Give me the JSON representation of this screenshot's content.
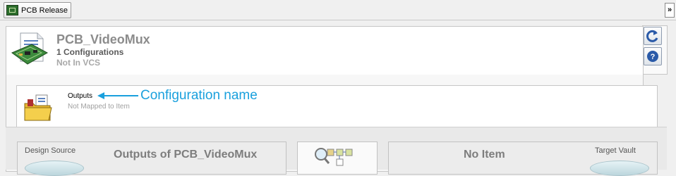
{
  "tab": {
    "label": "PCB Release"
  },
  "overflow": {
    "label": "»"
  },
  "project": {
    "title": "PCB_VideoMux",
    "configurations": "1 Configurations",
    "vcs_status": "Not In VCS"
  },
  "configuration": {
    "name": "Outputs",
    "mapping": "Not Mapped to Item",
    "annotation": "Configuration name"
  },
  "source": {
    "label": "Design Source",
    "title": "Outputs of PCB_VideoMux"
  },
  "target": {
    "label": "Target Vault",
    "title": "No Item"
  },
  "colors": {
    "annotation": "#1aa0dd",
    "title_gray": "#8c8c8c"
  },
  "icons": [
    "pcb-document-icon",
    "refresh-icon",
    "help-icon",
    "configuration-folder-icon",
    "process-flow-icon"
  ]
}
